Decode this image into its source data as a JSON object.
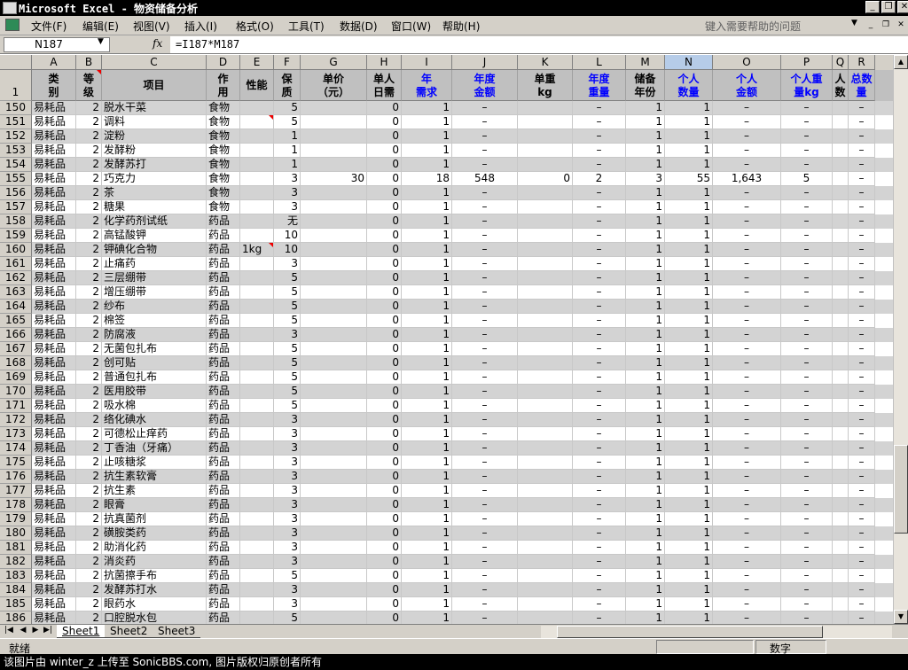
{
  "window": {
    "title": "Microsoft Excel - 物资储备分析",
    "min": "_",
    "max": "❐",
    "close": "✕"
  },
  "menu": {
    "items": [
      "文件(F)",
      "编辑(E)",
      "视图(V)",
      "插入(I)",
      "格式(O)",
      "工具(T)",
      "数据(D)",
      "窗口(W)",
      "帮助(H)"
    ],
    "help_placeholder": "键入需要帮助的问题"
  },
  "formula_bar": {
    "name_box": "N187",
    "fx": "fx",
    "formula": "=I187*M187"
  },
  "columns": [
    "A",
    "B",
    "C",
    "D",
    "E",
    "F",
    "G",
    "H",
    "I",
    "J",
    "K",
    "L",
    "M",
    "N",
    "O",
    "P",
    "Q",
    "R"
  ],
  "header_row_number": "1",
  "headers": [
    "类\n别",
    "等\n级",
    "项目",
    "作\n用",
    "性能",
    "保\n质",
    "单价\n（元）",
    "单人\n日需",
    "年\n需求",
    "年度\n金额",
    "单重\nkg",
    "年度\n重量",
    "储备\n年份",
    "个人\n数量",
    "个人\n金额",
    "个人重\n量kg",
    "人\n数",
    "总数\n量"
  ],
  "blue_headers": [
    8,
    9,
    11,
    13,
    14,
    15,
    17
  ],
  "rows": [
    {
      "n": "150",
      "item": "脱水干菜",
      "use": "食物",
      "perf": "",
      "f": "5",
      "g": "",
      "h": "0",
      "i": "1",
      "j": "–",
      "k": "",
      "l": "–",
      "m": "1",
      "nn": "1",
      "o": "–",
      "p": "–",
      "r": "–"
    },
    {
      "n": "151",
      "item": "调料",
      "use": "食物",
      "perf": "",
      "f": "5",
      "g": "",
      "h": "0",
      "i": "1",
      "j": "–",
      "k": "",
      "l": "–",
      "m": "1",
      "nn": "1",
      "o": "–",
      "p": "–",
      "r": "–"
    },
    {
      "n": "152",
      "item": "淀粉",
      "use": "食物",
      "perf": "",
      "f": "1",
      "g": "",
      "h": "0",
      "i": "1",
      "j": "–",
      "k": "",
      "l": "–",
      "m": "1",
      "nn": "1",
      "o": "–",
      "p": "–",
      "r": "–"
    },
    {
      "n": "153",
      "item": "发酵粉",
      "use": "食物",
      "perf": "",
      "f": "1",
      "g": "",
      "h": "0",
      "i": "1",
      "j": "–",
      "k": "",
      "l": "–",
      "m": "1",
      "nn": "1",
      "o": "–",
      "p": "–",
      "r": "–"
    },
    {
      "n": "154",
      "item": "发酵苏打",
      "use": "食物",
      "perf": "",
      "f": "1",
      "g": "",
      "h": "0",
      "i": "1",
      "j": "–",
      "k": "",
      "l": "–",
      "m": "1",
      "nn": "1",
      "o": "–",
      "p": "–",
      "r": "–"
    },
    {
      "n": "155",
      "item": "巧克力",
      "use": "食物",
      "perf": "",
      "f": "3",
      "g": "30",
      "h": "0",
      "i": "18",
      "j": "548",
      "k": "0",
      "l": "2",
      "m": "3",
      "nn": "55",
      "o": "1,643",
      "p": "5",
      "r": "–"
    },
    {
      "n": "156",
      "item": "茶",
      "use": "食物",
      "perf": "",
      "f": "3",
      "g": "",
      "h": "0",
      "i": "1",
      "j": "–",
      "k": "",
      "l": "–",
      "m": "1",
      "nn": "1",
      "o": "–",
      "p": "–",
      "r": "–"
    },
    {
      "n": "157",
      "item": "糖果",
      "use": "食物",
      "perf": "",
      "f": "3",
      "g": "",
      "h": "0",
      "i": "1",
      "j": "–",
      "k": "",
      "l": "–",
      "m": "1",
      "nn": "1",
      "o": "–",
      "p": "–",
      "r": "–"
    },
    {
      "n": "158",
      "item": "化学药剂试纸",
      "use": "药品",
      "perf": "",
      "f": "无",
      "g": "",
      "h": "0",
      "i": "1",
      "j": "–",
      "k": "",
      "l": "–",
      "m": "1",
      "nn": "1",
      "o": "–",
      "p": "–",
      "r": "–"
    },
    {
      "n": "159",
      "item": "高锰酸钾",
      "use": "药品",
      "perf": "",
      "f": "10",
      "g": "",
      "h": "0",
      "i": "1",
      "j": "–",
      "k": "",
      "l": "–",
      "m": "1",
      "nn": "1",
      "o": "–",
      "p": "–",
      "r": "–"
    },
    {
      "n": "160",
      "item": "钾碘化合物",
      "use": "药品",
      "perf": "1kg",
      "f": "10",
      "g": "",
      "h": "0",
      "i": "1",
      "j": "–",
      "k": "",
      "l": "–",
      "m": "1",
      "nn": "1",
      "o": "–",
      "p": "–",
      "r": "–"
    },
    {
      "n": "161",
      "item": "止痛药",
      "use": "药品",
      "perf": "",
      "f": "3",
      "g": "",
      "h": "0",
      "i": "1",
      "j": "–",
      "k": "",
      "l": "–",
      "m": "1",
      "nn": "1",
      "o": "–",
      "p": "–",
      "r": "–"
    },
    {
      "n": "162",
      "item": "三层绷带",
      "use": "药品",
      "perf": "",
      "f": "5",
      "g": "",
      "h": "0",
      "i": "1",
      "j": "–",
      "k": "",
      "l": "–",
      "m": "1",
      "nn": "1",
      "o": "–",
      "p": "–",
      "r": "–"
    },
    {
      "n": "163",
      "item": "增压绷带",
      "use": "药品",
      "perf": "",
      "f": "5",
      "g": "",
      "h": "0",
      "i": "1",
      "j": "–",
      "k": "",
      "l": "–",
      "m": "1",
      "nn": "1",
      "o": "–",
      "p": "–",
      "r": "–"
    },
    {
      "n": "164",
      "item": "纱布",
      "use": "药品",
      "perf": "",
      "f": "5",
      "g": "",
      "h": "0",
      "i": "1",
      "j": "–",
      "k": "",
      "l": "–",
      "m": "1",
      "nn": "1",
      "o": "–",
      "p": "–",
      "r": "–"
    },
    {
      "n": "165",
      "item": "棉签",
      "use": "药品",
      "perf": "",
      "f": "5",
      "g": "",
      "h": "0",
      "i": "1",
      "j": "–",
      "k": "",
      "l": "–",
      "m": "1",
      "nn": "1",
      "o": "–",
      "p": "–",
      "r": "–"
    },
    {
      "n": "166",
      "item": "防腐液",
      "use": "药品",
      "perf": "",
      "f": "3",
      "g": "",
      "h": "0",
      "i": "1",
      "j": "–",
      "k": "",
      "l": "–",
      "m": "1",
      "nn": "1",
      "o": "–",
      "p": "–",
      "r": "–"
    },
    {
      "n": "167",
      "item": "无菌包扎布",
      "use": "药品",
      "perf": "",
      "f": "5",
      "g": "",
      "h": "0",
      "i": "1",
      "j": "–",
      "k": "",
      "l": "–",
      "m": "1",
      "nn": "1",
      "o": "–",
      "p": "–",
      "r": "–"
    },
    {
      "n": "168",
      "item": "创可贴",
      "use": "药品",
      "perf": "",
      "f": "5",
      "g": "",
      "h": "0",
      "i": "1",
      "j": "–",
      "k": "",
      "l": "–",
      "m": "1",
      "nn": "1",
      "o": "–",
      "p": "–",
      "r": "–"
    },
    {
      "n": "169",
      "item": "普通包扎布",
      "use": "药品",
      "perf": "",
      "f": "5",
      "g": "",
      "h": "0",
      "i": "1",
      "j": "–",
      "k": "",
      "l": "–",
      "m": "1",
      "nn": "1",
      "o": "–",
      "p": "–",
      "r": "–"
    },
    {
      "n": "170",
      "item": "医用胶带",
      "use": "药品",
      "perf": "",
      "f": "5",
      "g": "",
      "h": "0",
      "i": "1",
      "j": "–",
      "k": "",
      "l": "–",
      "m": "1",
      "nn": "1",
      "o": "–",
      "p": "–",
      "r": "–"
    },
    {
      "n": "171",
      "item": "吸水棉",
      "use": "药品",
      "perf": "",
      "f": "5",
      "g": "",
      "h": "0",
      "i": "1",
      "j": "–",
      "k": "",
      "l": "–",
      "m": "1",
      "nn": "1",
      "o": "–",
      "p": "–",
      "r": "–"
    },
    {
      "n": "172",
      "item": "络化碘水",
      "use": "药品",
      "perf": "",
      "f": "3",
      "g": "",
      "h": "0",
      "i": "1",
      "j": "–",
      "k": "",
      "l": "–",
      "m": "1",
      "nn": "1",
      "o": "–",
      "p": "–",
      "r": "–"
    },
    {
      "n": "173",
      "item": "可德松止痒药",
      "use": "药品",
      "perf": "",
      "f": "3",
      "g": "",
      "h": "0",
      "i": "1",
      "j": "–",
      "k": "",
      "l": "–",
      "m": "1",
      "nn": "1",
      "o": "–",
      "p": "–",
      "r": "–"
    },
    {
      "n": "174",
      "item": "丁香油（牙痛）",
      "use": "药品",
      "perf": "",
      "f": "3",
      "g": "",
      "h": "0",
      "i": "1",
      "j": "–",
      "k": "",
      "l": "–",
      "m": "1",
      "nn": "1",
      "o": "–",
      "p": "–",
      "r": "–"
    },
    {
      "n": "175",
      "item": "止咳糖浆",
      "use": "药品",
      "perf": "",
      "f": "3",
      "g": "",
      "h": "0",
      "i": "1",
      "j": "–",
      "k": "",
      "l": "–",
      "m": "1",
      "nn": "1",
      "o": "–",
      "p": "–",
      "r": "–"
    },
    {
      "n": "176",
      "item": "抗生素软膏",
      "use": "药品",
      "perf": "",
      "f": "3",
      "g": "",
      "h": "0",
      "i": "1",
      "j": "–",
      "k": "",
      "l": "–",
      "m": "1",
      "nn": "1",
      "o": "–",
      "p": "–",
      "r": "–"
    },
    {
      "n": "177",
      "item": "抗生素",
      "use": "药品",
      "perf": "",
      "f": "3",
      "g": "",
      "h": "0",
      "i": "1",
      "j": "–",
      "k": "",
      "l": "–",
      "m": "1",
      "nn": "1",
      "o": "–",
      "p": "–",
      "r": "–"
    },
    {
      "n": "178",
      "item": "眼膏",
      "use": "药品",
      "perf": "",
      "f": "3",
      "g": "",
      "h": "0",
      "i": "1",
      "j": "–",
      "k": "",
      "l": "–",
      "m": "1",
      "nn": "1",
      "o": "–",
      "p": "–",
      "r": "–"
    },
    {
      "n": "179",
      "item": "抗真菌剂",
      "use": "药品",
      "perf": "",
      "f": "3",
      "g": "",
      "h": "0",
      "i": "1",
      "j": "–",
      "k": "",
      "l": "–",
      "m": "1",
      "nn": "1",
      "o": "–",
      "p": "–",
      "r": "–"
    },
    {
      "n": "180",
      "item": "磺胺类药",
      "use": "药品",
      "perf": "",
      "f": "3",
      "g": "",
      "h": "0",
      "i": "1",
      "j": "–",
      "k": "",
      "l": "–",
      "m": "1",
      "nn": "1",
      "o": "–",
      "p": "–",
      "r": "–"
    },
    {
      "n": "181",
      "item": "助消化药",
      "use": "药品",
      "perf": "",
      "f": "3",
      "g": "",
      "h": "0",
      "i": "1",
      "j": "–",
      "k": "",
      "l": "–",
      "m": "1",
      "nn": "1",
      "o": "–",
      "p": "–",
      "r": "–"
    },
    {
      "n": "182",
      "item": "消炎药",
      "use": "药品",
      "perf": "",
      "f": "3",
      "g": "",
      "h": "0",
      "i": "1",
      "j": "–",
      "k": "",
      "l": "–",
      "m": "1",
      "nn": "1",
      "o": "–",
      "p": "–",
      "r": "–"
    },
    {
      "n": "183",
      "item": "抗菌擦手布",
      "use": "药品",
      "perf": "",
      "f": "5",
      "g": "",
      "h": "0",
      "i": "1",
      "j": "–",
      "k": "",
      "l": "–",
      "m": "1",
      "nn": "1",
      "o": "–",
      "p": "–",
      "r": "–"
    },
    {
      "n": "184",
      "item": "发酵苏打水",
      "use": "药品",
      "perf": "",
      "f": "3",
      "g": "",
      "h": "0",
      "i": "1",
      "j": "–",
      "k": "",
      "l": "–",
      "m": "1",
      "nn": "1",
      "o": "–",
      "p": "–",
      "r": "–"
    },
    {
      "n": "185",
      "item": "眼药水",
      "use": "药品",
      "perf": "",
      "f": "3",
      "g": "",
      "h": "0",
      "i": "1",
      "j": "–",
      "k": "",
      "l": "–",
      "m": "1",
      "nn": "1",
      "o": "–",
      "p": "–",
      "r": "–"
    },
    {
      "n": "186",
      "item": "口腔脱水包",
      "use": "药品",
      "perf": "",
      "f": "5",
      "g": "",
      "h": "0",
      "i": "1",
      "j": "–",
      "k": "",
      "l": "–",
      "m": "1",
      "nn": "1",
      "o": "–",
      "p": "–",
      "r": "–"
    }
  ],
  "row_category": "易耗品",
  "row_level": "2",
  "comment_rows": [
    "151",
    "160"
  ],
  "sheets": [
    "Sheet1",
    "Sheet2",
    "Sheet3"
  ],
  "status": {
    "ready": "就绪",
    "mode": "数字"
  },
  "footer": "该图片由 winter_z 上传至 SonicBBS.com, 图片版权归原创者所有",
  "colors": {
    "header_bg": "#c0c0c0",
    "band_bg": "#d3d3d3",
    "blue_text": "#0000ff",
    "selected_col": "#b6cce8"
  }
}
